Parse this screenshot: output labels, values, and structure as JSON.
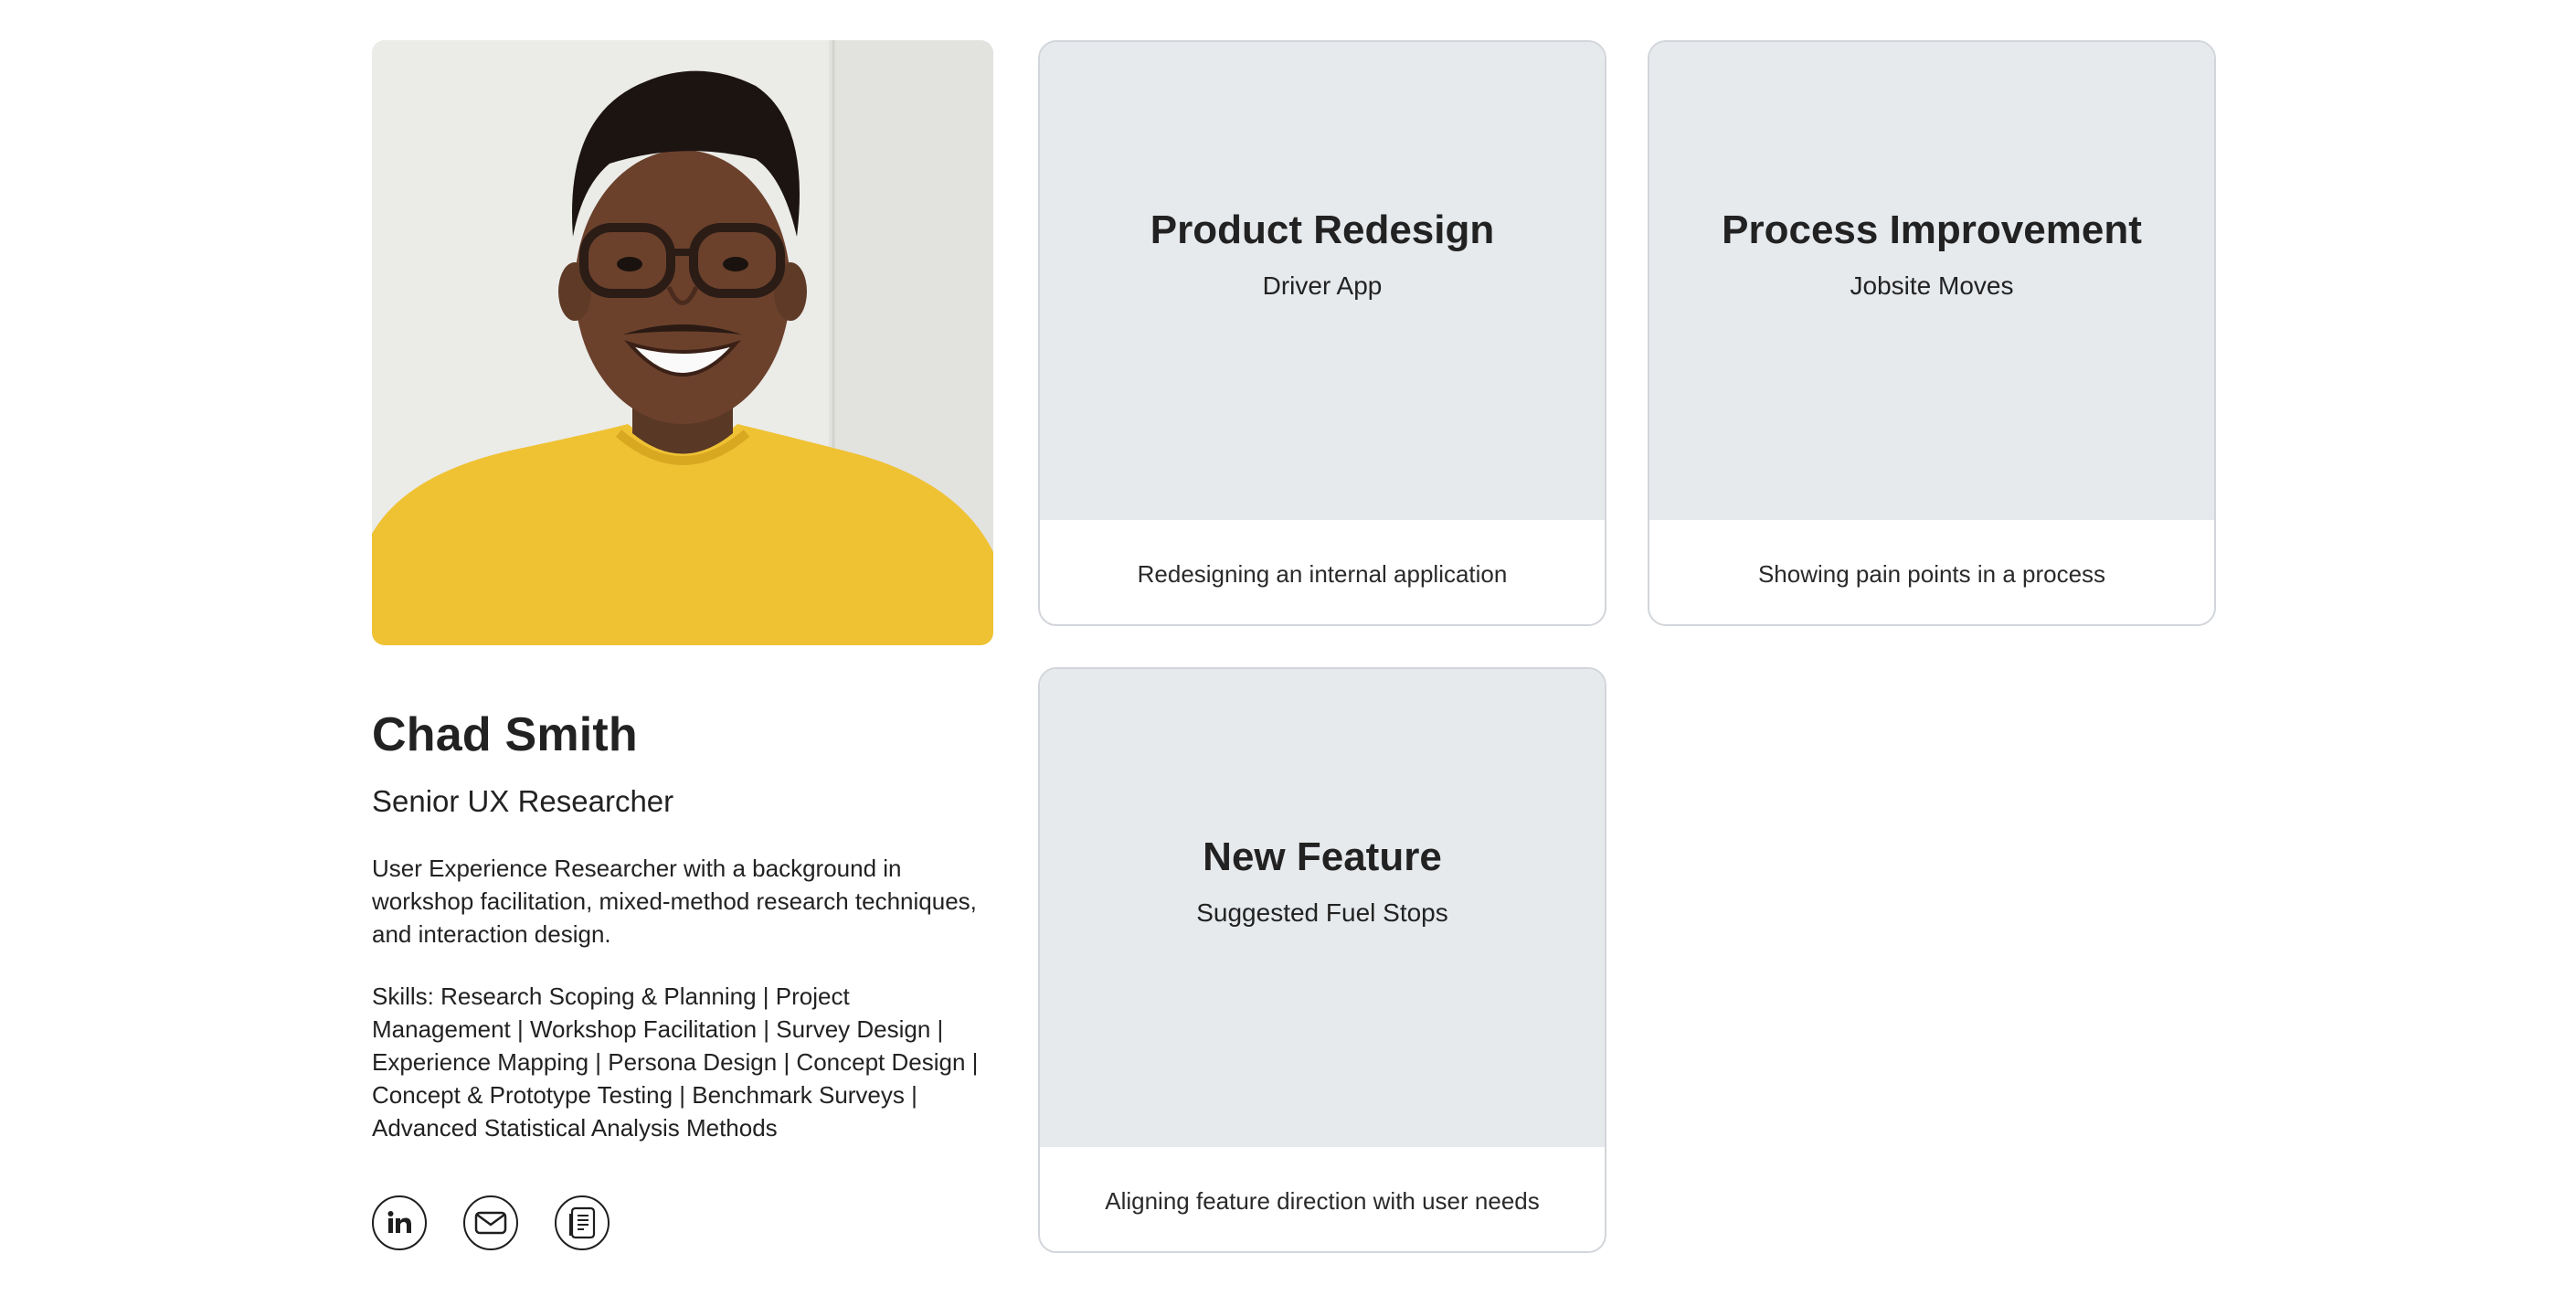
{
  "profile": {
    "name": "Chad Smith",
    "role": "Senior UX Researcher",
    "bio": "User Experience Researcher with a background in workshop facilitation, mixed-method research techniques, and interaction design.",
    "skills": "Skills: Research Scoping & Planning | Project Management | Workshop Facilitation | Survey Design | Experience Mapping | Persona Design | Concept Design | Concept & Prototype Testing | Benchmark Surveys | Advanced Statistical Analysis Methods",
    "photo_icon": "portrait-photo",
    "socials": [
      {
        "icon": "linkedin-icon"
      },
      {
        "icon": "email-icon"
      },
      {
        "icon": "resume-document-icon"
      }
    ]
  },
  "cards": [
    {
      "title": "Product Redesign",
      "subtitle": "Driver App",
      "description": "Redesigning an internal application"
    },
    {
      "title": "Process Improvement",
      "subtitle": "Jobsite Moves",
      "description": "Showing pain points in a process"
    },
    {
      "title": "New Feature",
      "subtitle": "Suggested Fuel Stops",
      "description": "Aligning feature direction with user needs"
    }
  ],
  "colors": {
    "card_top_bg": "#e7eaed",
    "card_border": "#d2d5da",
    "text": "#222222",
    "shirt": "#f0c53a"
  }
}
